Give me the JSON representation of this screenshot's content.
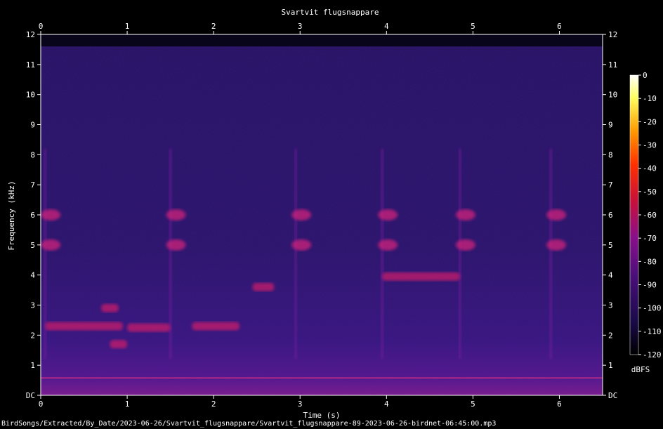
{
  "chart_data": {
    "type": "heatmap",
    "title": "Svartvit flugsnappare",
    "xlabel": "Time (s)",
    "ylabel": "Frequency (kHz)",
    "xlim": [
      0,
      6.5
    ],
    "ylim": [
      0,
      12
    ],
    "x_ticks": [
      "0",
      "1",
      "2",
      "3",
      "4",
      "5",
      "6"
    ],
    "y_ticks": [
      "DC",
      "1",
      "2",
      "3",
      "4",
      "5",
      "6",
      "7",
      "8",
      "9",
      "10",
      "11",
      "12"
    ],
    "colorbar": {
      "label": "dBFS",
      "range": [
        -120,
        0
      ],
      "ticks": [
        "0",
        "-10",
        "-20",
        "-30",
        "-40",
        "-50",
        "-60",
        "-70",
        "-80",
        "-90",
        "-100",
        "-110",
        "-120"
      ],
      "colors": [
        "#000000",
        "#1a0a4a",
        "#4a0f7a",
        "#8a0f8a",
        "#c8103a",
        "#ff3000",
        "#ff9a00",
        "#ffff60",
        "#ffffff"
      ]
    },
    "calls_time_s": [
      0.05,
      1.5,
      2.95,
      3.95,
      4.85,
      5.9
    ],
    "call_freq_khz": [
      6.0,
      5.0
    ]
  },
  "footer": "BirdSongs/Extracted/By_Date/2023-06-26/Svartvit_flugsnappare/Svartvit_flugsnappare-89-2023-06-26-birdnet-06:45:00.mp3"
}
